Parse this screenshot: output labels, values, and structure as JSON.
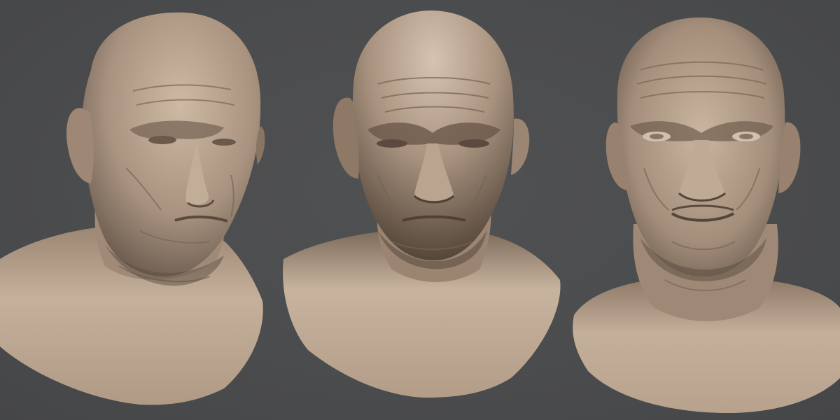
{
  "scene": {
    "background_color": "#4a4b4d",
    "material_color": "#b39d88",
    "material_shadow": "#5a4c40",
    "material_highlight": "#d9c7b3"
  },
  "busts": [
    {
      "view": "three-quarter-left",
      "icon": "sculpted-head-bust"
    },
    {
      "view": "front-lit-from-above",
      "icon": "sculpted-head-bust"
    },
    {
      "view": "front-lit-from-front",
      "icon": "sculpted-head-bust"
    }
  ]
}
